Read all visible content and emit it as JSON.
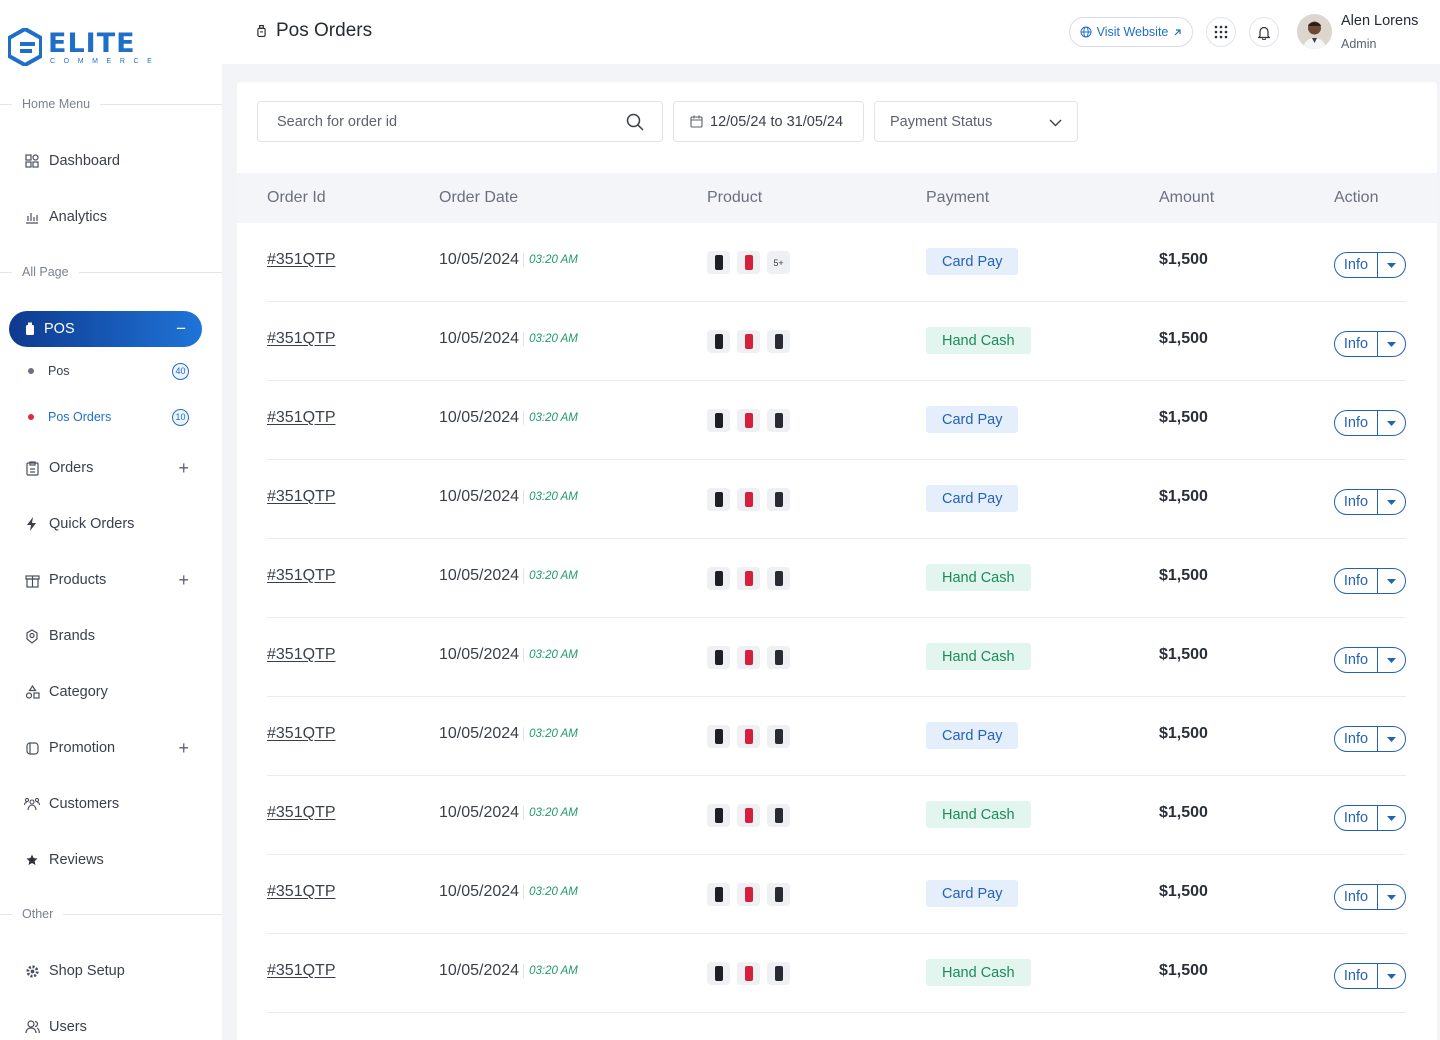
{
  "brand": {
    "title": "ELITE",
    "subtitle": "COMMERCE"
  },
  "sidebar": {
    "sections": {
      "home": "Home Menu",
      "all": "All Page",
      "other": "Other"
    },
    "home_items": [
      {
        "label": "Dashboard",
        "icon": "dashboard-icon"
      },
      {
        "label": "Analytics",
        "icon": "analytics-icon"
      }
    ],
    "active": {
      "label": "POS",
      "icon": "pos-icon"
    },
    "pos_sub": [
      {
        "label": "Pos",
        "count": "40"
      },
      {
        "label": "Pos Orders",
        "count": "10"
      }
    ],
    "page_items": [
      {
        "label": "Orders",
        "icon": "orders-icon",
        "expandable": true
      },
      {
        "label": "Quick Orders",
        "icon": "bolt-icon",
        "expandable": false
      },
      {
        "label": "Products",
        "icon": "products-icon",
        "expandable": true
      },
      {
        "label": "Brands",
        "icon": "brands-icon",
        "expandable": false
      },
      {
        "label": "Category",
        "icon": "category-icon",
        "expandable": false
      },
      {
        "label": "Promotion",
        "icon": "promotion-icon",
        "expandable": true
      },
      {
        "label": "Customers",
        "icon": "customers-icon",
        "expandable": false
      },
      {
        "label": "Reviews",
        "icon": "star-icon",
        "expandable": false
      }
    ],
    "other_items": [
      {
        "label": "Shop Setup",
        "icon": "gear-icon"
      },
      {
        "label": "Users",
        "icon": "users-icon"
      }
    ]
  },
  "header": {
    "title": "Pos Orders",
    "visit_label": "Visit Website",
    "user_name": "Alen Lorens",
    "user_role": "Admin"
  },
  "filters": {
    "search_placeholder": "Search for order id",
    "date_range": "12/05/24 to 31/05/24",
    "status_placeholder": "Payment Status"
  },
  "table": {
    "columns": [
      "Order Id",
      "Order Date",
      "Product",
      "Payment",
      "Amount",
      "Action"
    ],
    "action_label": "Info",
    "rows": [
      {
        "id": "#351QTP",
        "date": "10/05/2024",
        "time": "03:20 AM",
        "extra": "5+",
        "payment": "Card Pay",
        "type": "card",
        "amount": "$1,500"
      },
      {
        "id": "#351QTP",
        "date": "10/05/2024",
        "time": "03:20 AM",
        "extra": "",
        "payment": "Hand Cash",
        "type": "cash",
        "amount": "$1,500"
      },
      {
        "id": "#351QTP",
        "date": "10/05/2024",
        "time": "03:20 AM",
        "extra": "",
        "payment": "Card Pay",
        "type": "card",
        "amount": "$1,500"
      },
      {
        "id": "#351QTP",
        "date": "10/05/2024",
        "time": "03:20 AM",
        "extra": "",
        "payment": "Card Pay",
        "type": "card",
        "amount": "$1,500"
      },
      {
        "id": "#351QTP",
        "date": "10/05/2024",
        "time": "03:20 AM",
        "extra": "",
        "payment": "Hand Cash",
        "type": "cash",
        "amount": "$1,500"
      },
      {
        "id": "#351QTP",
        "date": "10/05/2024",
        "time": "03:20 AM",
        "extra": "",
        "payment": "Hand Cash",
        "type": "cash",
        "amount": "$1,500"
      },
      {
        "id": "#351QTP",
        "date": "10/05/2024",
        "time": "03:20 AM",
        "extra": "",
        "payment": "Card Pay",
        "type": "card",
        "amount": "$1,500"
      },
      {
        "id": "#351QTP",
        "date": "10/05/2024",
        "time": "03:20 AM",
        "extra": "",
        "payment": "Hand Cash",
        "type": "cash",
        "amount": "$1,500"
      },
      {
        "id": "#351QTP",
        "date": "10/05/2024",
        "time": "03:20 AM",
        "extra": "",
        "payment": "Card Pay",
        "type": "card",
        "amount": "$1,500"
      },
      {
        "id": "#351QTP",
        "date": "10/05/2024",
        "time": "03:20 AM",
        "extra": "",
        "payment": "Hand Cash",
        "type": "cash",
        "amount": "$1,500"
      }
    ]
  },
  "colors": {
    "accent": "#1f6fc9",
    "active_gradient_start": "#0e3a8f",
    "card_badge": "#e5eefb",
    "cash_badge": "#e2f5ee",
    "time_text": "#1f9a6a"
  }
}
